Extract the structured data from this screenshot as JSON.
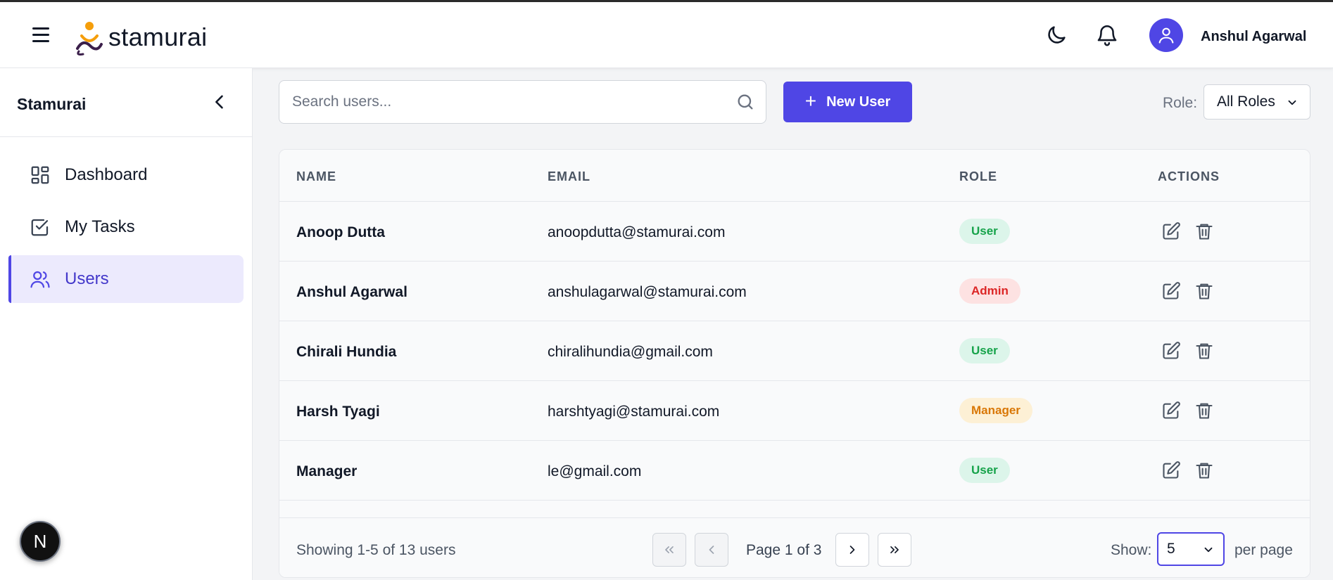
{
  "header": {
    "brand": "stamurai",
    "user_name": "Anshul Agarwal",
    "icons": [
      "menu-icon",
      "moon-icon",
      "bell-icon",
      "user-icon"
    ]
  },
  "sidebar": {
    "title": "Stamurai",
    "items": [
      {
        "label": "Dashboard",
        "icon": "grid-icon",
        "active": false
      },
      {
        "label": "My Tasks",
        "icon": "check-square-icon",
        "active": false
      },
      {
        "label": "Users",
        "icon": "users-icon",
        "active": true
      }
    ],
    "badge_letter": "N"
  },
  "toolbar": {
    "search_placeholder": "Search users...",
    "new_user_label": "New User",
    "role_label": "Role:",
    "role_value": "All Roles"
  },
  "table": {
    "headers": [
      "NAME",
      "EMAIL",
      "ROLE",
      "ACTIONS"
    ],
    "rows": [
      {
        "name": "Anoop Dutta",
        "email": "anoopdutta@stamurai.com",
        "role": "User"
      },
      {
        "name": "Anshul Agarwal",
        "email": "anshulagarwal@stamurai.com",
        "role": "Admin"
      },
      {
        "name": "Chirali Hundia",
        "email": "chiralihundia@gmail.com",
        "role": "User"
      },
      {
        "name": "Harsh Tyagi",
        "email": "harshtyagi@stamurai.com",
        "role": "Manager"
      },
      {
        "name": "Manager",
        "email": "le@gmail.com",
        "role": "User"
      }
    ]
  },
  "pagination": {
    "showing": "Showing 1-5 of 13 users",
    "page_text": "Page 1 of 3",
    "show_label": "Show:",
    "per_page_value": "5",
    "per_page_label": "per page"
  },
  "colors": {
    "accent": "#4f46e5",
    "user_badge": "#16a34a",
    "admin_badge": "#dc2626",
    "manager_badge": "#d97706"
  }
}
